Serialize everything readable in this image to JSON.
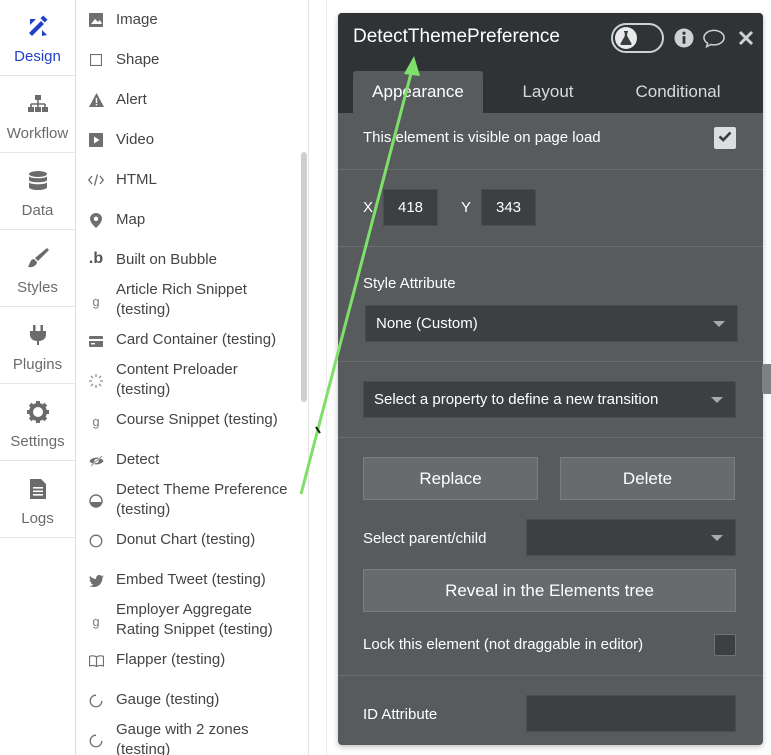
{
  "nav": {
    "items": [
      {
        "label": "Design",
        "icon": "design-icon"
      },
      {
        "label": "Workflow",
        "icon": "workflow-icon"
      },
      {
        "label": "Data",
        "icon": "database-icon"
      },
      {
        "label": "Styles",
        "icon": "brush-icon"
      },
      {
        "label": "Plugins",
        "icon": "plug-icon"
      },
      {
        "label": "Settings",
        "icon": "gear-icon"
      },
      {
        "label": "Logs",
        "icon": "document-icon"
      }
    ]
  },
  "palette": {
    "items": [
      {
        "line1": "Image",
        "line2": ""
      },
      {
        "line1": "Shape",
        "line2": ""
      },
      {
        "line1": "Alert",
        "line2": ""
      },
      {
        "line1": "Video",
        "line2": ""
      },
      {
        "line1": "HTML",
        "line2": ""
      },
      {
        "line1": "Map",
        "line2": ""
      },
      {
        "line1": "Built on Bubble",
        "line2": ""
      },
      {
        "line1": "Article Rich Snippet",
        "line2": "(testing)"
      },
      {
        "line1": "Card Container (testing)",
        "line2": ""
      },
      {
        "line1": "Content Preloader",
        "line2": "(testing)"
      },
      {
        "line1": "Course Snippet (testing)",
        "line2": ""
      },
      {
        "line1": "Detect",
        "line2": ""
      },
      {
        "line1": "Detect Theme Preference",
        "line2": "(testing)"
      },
      {
        "line1": "Donut Chart (testing)",
        "line2": ""
      },
      {
        "line1": "Embed Tweet (testing)",
        "line2": ""
      },
      {
        "line1": "Employer Aggregate",
        "line2": "Rating Snippet (testing)"
      },
      {
        "line1": "Flapper (testing)",
        "line2": ""
      },
      {
        "line1": "Gauge (testing)",
        "line2": ""
      },
      {
        "line1": "Gauge with 2 zones",
        "line2": "(testing)"
      }
    ]
  },
  "editor": {
    "title": "DetectThemePreference",
    "tabs": [
      "Appearance",
      "Layout",
      "Conditional"
    ],
    "visible_label": "This element is visible on page load",
    "x_label": "X",
    "x_value": "418",
    "y_label": "Y",
    "y_value": "343",
    "style_attr_label": "Style Attribute",
    "style_value": "None (Custom)",
    "transition_placeholder": "Select a property to define a new transition",
    "replace_label": "Replace",
    "delete_label": "Delete",
    "parent_child_label": "Select parent/child",
    "reveal_label": "Reveal in the Elements tree",
    "lock_label": "Lock this element (not draggable in editor)",
    "id_attr_label": "ID Attribute"
  },
  "colors": {
    "accent": "#2140c6",
    "panel": "#575b5d",
    "panel_header": "#2f3335",
    "annotation_arrow": "#7ee06a"
  }
}
